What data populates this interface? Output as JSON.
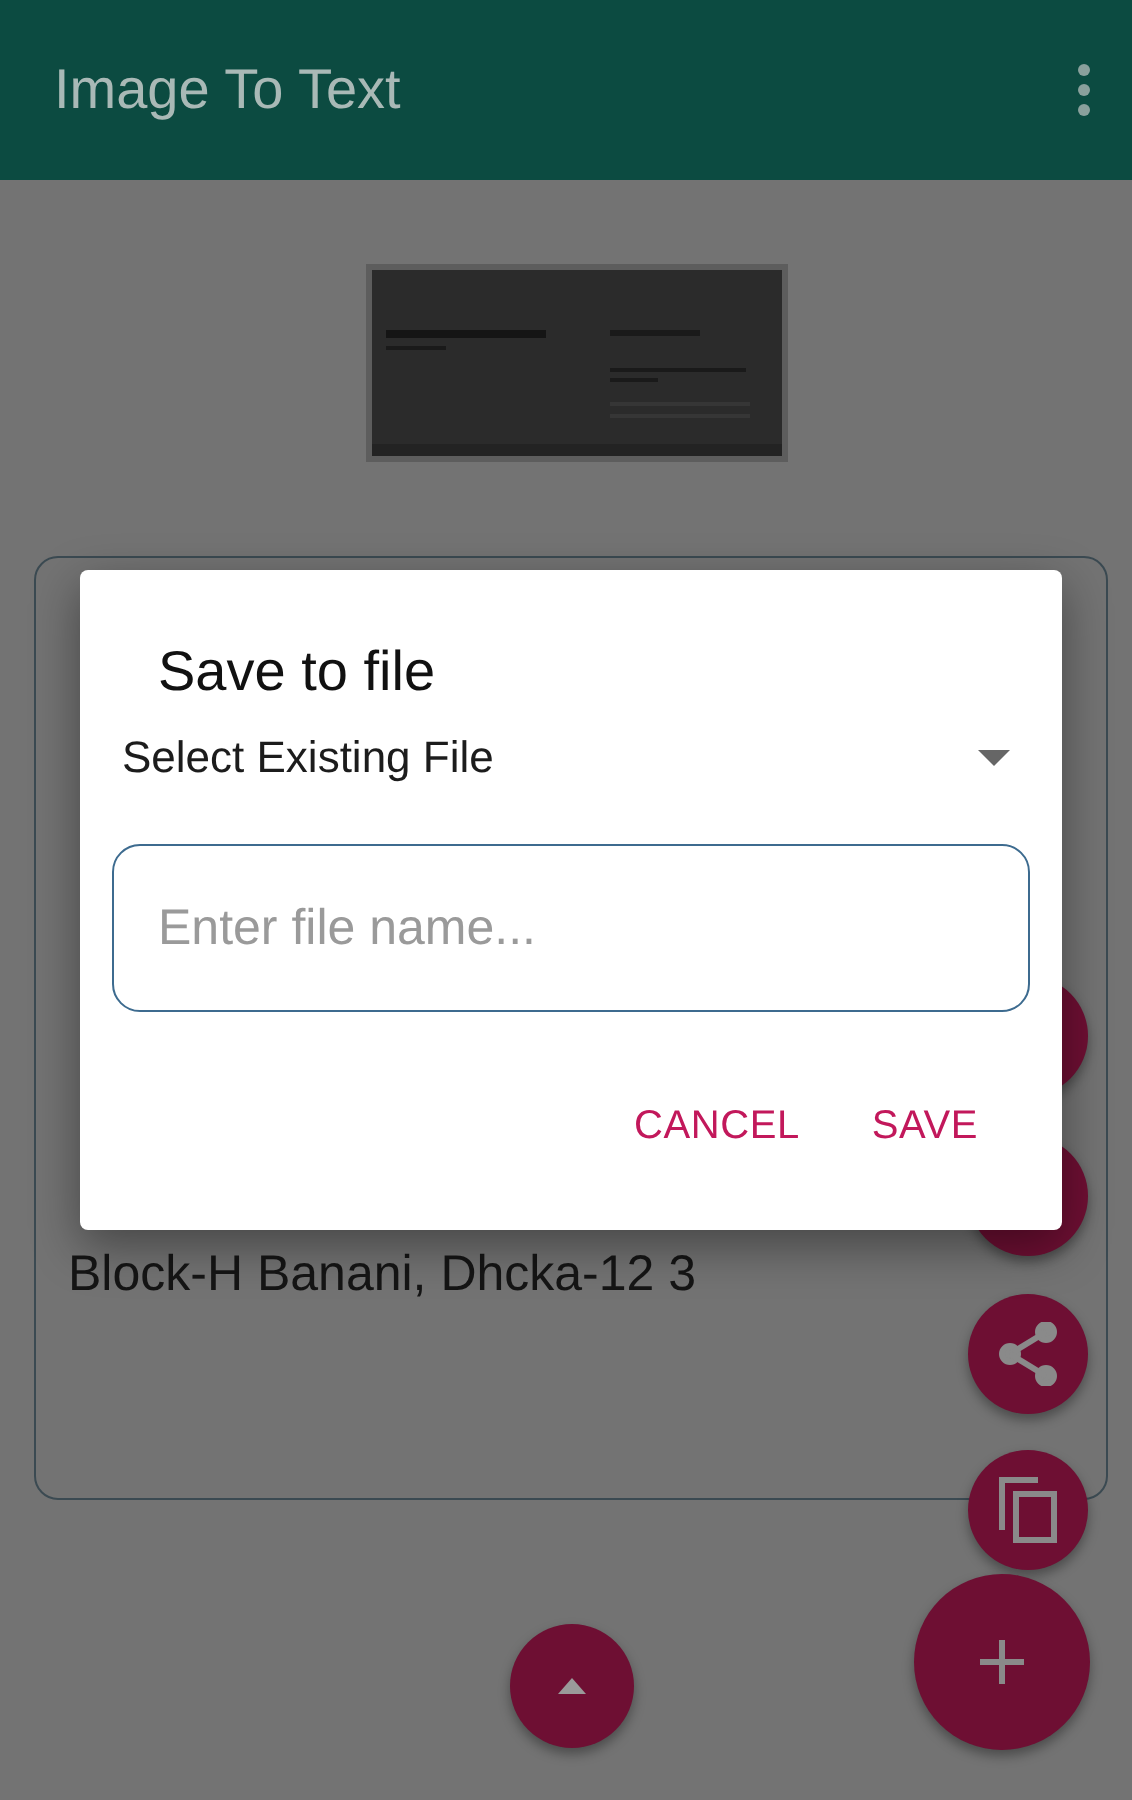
{
  "app_bar": {
    "title": "Image To Text"
  },
  "result_text": {
    "lines": [
      "Block-H Banani, Dhcka-12 3"
    ]
  },
  "dialog": {
    "title": "Save to file",
    "dropdown": {
      "label": "Select Existing File"
    },
    "file_name": {
      "placeholder": "Enter file name..."
    },
    "buttons": [
      "CANCEL",
      "SAVE"
    ]
  },
  "fabs": [
    {
      "kind": "blank"
    },
    {
      "kind": "blank"
    },
    {
      "kind": "share"
    },
    {
      "kind": "copy"
    },
    {
      "kind": "add"
    },
    {
      "kind": "up"
    }
  ]
}
